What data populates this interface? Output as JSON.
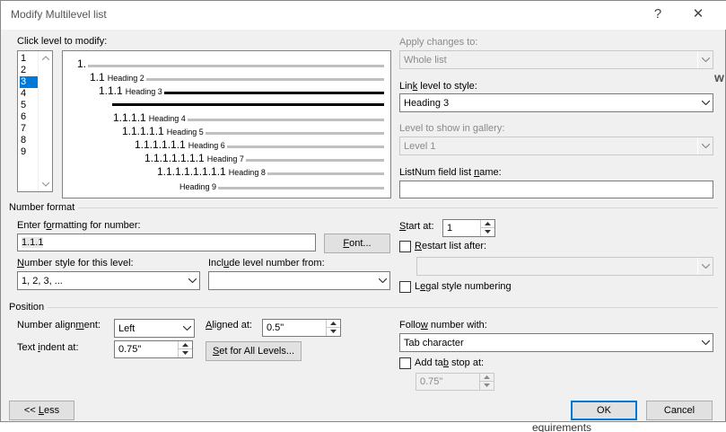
{
  "title": "Modify Multilevel list",
  "titlebar": {
    "help": "?",
    "close": "✕"
  },
  "level_list": {
    "label": "Click level to modify:",
    "items": [
      "1",
      "2",
      "3",
      "4",
      "5",
      "6",
      "7",
      "8",
      "9"
    ],
    "selected_index": 2
  },
  "preview": {
    "rows": [
      {
        "number": "1.",
        "heading": ""
      },
      {
        "number": "1.1",
        "heading": "Heading 2"
      },
      {
        "number": "1.1.1",
        "heading": "Heading 3"
      },
      {
        "number": "1.1.1.1",
        "heading": "Heading 4"
      },
      {
        "number": "1.1.1.1.1",
        "heading": "Heading 5"
      },
      {
        "number": "1.1.1.1.1.1",
        "heading": "Heading 6"
      },
      {
        "number": "1.1.1.1.1.1.1",
        "heading": "Heading 7"
      },
      {
        "number": "1.1.1.1.1.1.1.1",
        "heading": "Heading 8"
      },
      {
        "number": "",
        "heading": "Heading 9"
      }
    ]
  },
  "apply_changes": {
    "label": "Apply changes to:",
    "value": "Whole list"
  },
  "link_level": {
    "label": "Link level to style:",
    "value": "Heading 3"
  },
  "gallery_level": {
    "label": "Level to show in gallery:",
    "value": "Level 1"
  },
  "listnum": {
    "label": "ListNum field list name:",
    "value": ""
  },
  "number_format": {
    "section": "Number format",
    "enter_label": "Enter formatting for number:",
    "format_value": "1.1.1",
    "font_button": "Font...",
    "style_label": "Number style for this level:",
    "style_value": "1, 2, 3, ...",
    "include_label": "Include level number from:",
    "include_value": ""
  },
  "start_at": {
    "label": "Start at:",
    "value": "1"
  },
  "restart": {
    "label": "Restart list after:",
    "value": ""
  },
  "legal": {
    "label": "Legal style numbering"
  },
  "position": {
    "section": "Position",
    "alignment_label": "Number alignment:",
    "alignment_value": "Left",
    "aligned_at_label": "Aligned at:",
    "aligned_at_value": "0.5\"",
    "indent_label": "Text indent at:",
    "indent_value": "0.75\"",
    "set_all_button": "Set for All Levels...",
    "follow_label": "Follow number with:",
    "follow_value": "Tab character",
    "add_tab_label": "Add tab stop at:",
    "add_tab_value": "0.75\""
  },
  "buttons": {
    "less": "<< Less",
    "ok": "OK",
    "cancel": "Cancel"
  },
  "background_text": {
    "right_fragment_1": "w",
    "right_fragment_2": "equirements"
  }
}
